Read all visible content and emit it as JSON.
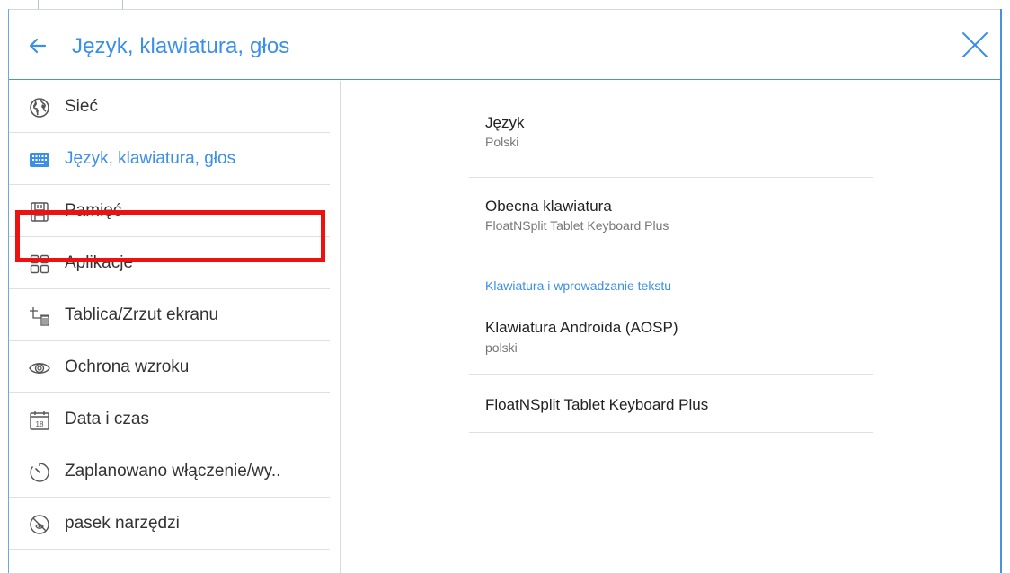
{
  "header": {
    "title": "Język, klawiatura, głos",
    "back_icon": "arrow-left-icon",
    "close_icon": "close-icon"
  },
  "sidebar": {
    "items": [
      {
        "label": "Sieć",
        "icon": "globe-icon"
      },
      {
        "label": "Język, klawiatura, głos",
        "icon": "keyboard-icon",
        "active": true
      },
      {
        "label": "Pamięć",
        "icon": "storage-icon"
      },
      {
        "label": "Aplikacje",
        "icon": "apps-grid-icon"
      },
      {
        "label": "Tablica/Zrzut ekranu",
        "icon": "screenshot-icon"
      },
      {
        "label": "Ochrona wzroku",
        "icon": "eye-icon"
      },
      {
        "label": "Data i czas",
        "icon": "calendar-icon"
      },
      {
        "label": "Zaplanowano włączenie/wy..",
        "icon": "timer-icon"
      },
      {
        "label": "pasek narzędzi",
        "icon": "toolbar-icon"
      }
    ]
  },
  "content": {
    "language": {
      "title": "Język",
      "value": "Polski"
    },
    "current_keyboard": {
      "title": "Obecna klawiatura",
      "value": "FloatNSplit Tablet Keyboard Plus"
    },
    "section_header": "Klawiatura i wprowadzanie tekstu",
    "aosp_keyboard": {
      "title": "Klawiatura Androida (AOSP)",
      "value": "polski"
    },
    "floatnsplit_keyboard": {
      "title": "FloatNSplit Tablet Keyboard Plus"
    }
  },
  "calendar_day": "18",
  "colors": {
    "accent": "#3b8fe8",
    "highlight": "#ee1111"
  }
}
